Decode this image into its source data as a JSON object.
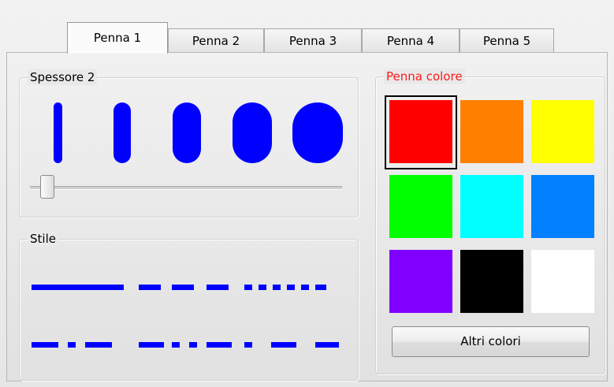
{
  "tabs": [
    {
      "label": "Penna 1",
      "active": true
    },
    {
      "label": "Penna 2",
      "active": false
    },
    {
      "label": "Penna 3",
      "active": false
    },
    {
      "label": "Penna 4",
      "active": false
    },
    {
      "label": "Penna 5",
      "active": false
    }
  ],
  "thickness": {
    "title": "Spessore 2",
    "pen_color": "#0000ff",
    "slider_level": 0.05
  },
  "style": {
    "title": "Stile",
    "line_color": "#0000ff"
  },
  "color_picker": {
    "title": "Penna colore",
    "title_color": "#ff1a1a",
    "colors": [
      "#ff0000",
      "#ff8000",
      "#ffff00",
      "#00ff00",
      "#00ffff",
      "#0080ff",
      "#8000ff",
      "#000000",
      "#ffffff"
    ],
    "selected_index": 0,
    "more_button_label": "Altri colori"
  }
}
